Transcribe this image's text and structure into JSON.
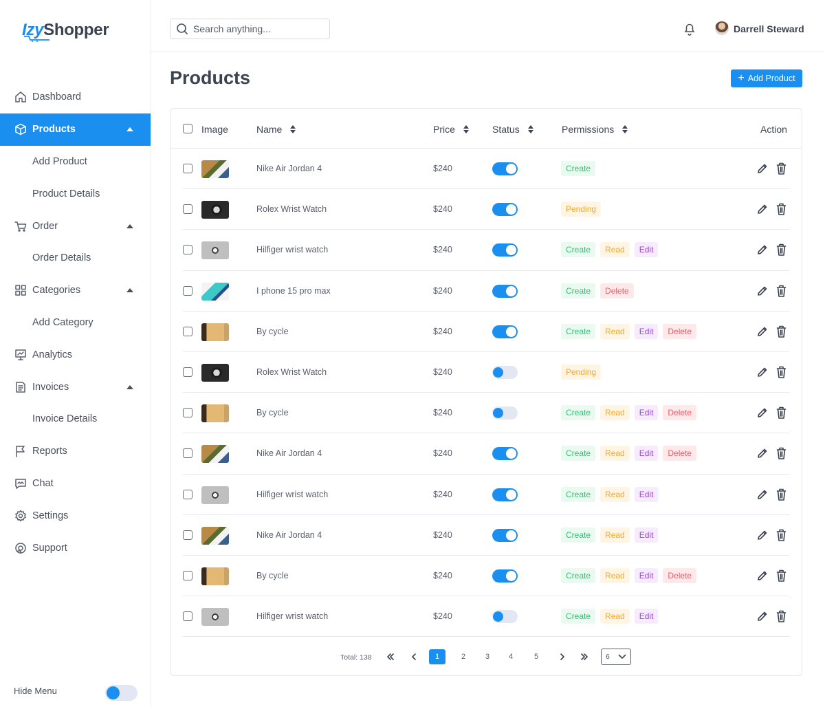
{
  "brand": {
    "part1": "Izy",
    "part2": "Shopper"
  },
  "search": {
    "placeholder": "Search anything..."
  },
  "user": {
    "name": "Darrell Steward"
  },
  "sidebar": {
    "items": [
      {
        "label": "Dashboard",
        "icon": "home-icon"
      },
      {
        "label": "Products",
        "icon": "box-icon"
      },
      {
        "label": "Add Product"
      },
      {
        "label": "Product Details"
      },
      {
        "label": "Order",
        "icon": "cart-icon"
      },
      {
        "label": "Order Details"
      },
      {
        "label": "Categories",
        "icon": "grid-icon"
      },
      {
        "label": "Add Category"
      },
      {
        "label": "Analytics",
        "icon": "monitor-icon"
      },
      {
        "label": "Invoices",
        "icon": "invoice-icon"
      },
      {
        "label": "Invoice Details"
      },
      {
        "label": "Reports",
        "icon": "flag-icon"
      },
      {
        "label": "Chat",
        "icon": "chat-icon"
      },
      {
        "label": "Settings",
        "icon": "gear-icon"
      },
      {
        "label": "Support",
        "icon": "support-icon"
      }
    ],
    "hide_menu": "Hide Menu"
  },
  "page": {
    "title": "Products",
    "add_button": "Add Product"
  },
  "table": {
    "headers": {
      "image": "Image",
      "name": "Name",
      "price": "Price",
      "status": "Status",
      "permissions": "Permissions",
      "action": "Action"
    },
    "rows": [
      {
        "name": "Nike Air Jordan 4",
        "price": "$240",
        "status": true,
        "image": "shoe",
        "perms": [
          "Create"
        ]
      },
      {
        "name": "Rolex Wrist Watch",
        "price": "$240",
        "status": true,
        "image": "watch",
        "perms": [
          "Pending"
        ]
      },
      {
        "name": "Hilfiger wrist watch",
        "price": "$240",
        "status": true,
        "image": "watch2",
        "perms": [
          "Create",
          "Read",
          "Edit"
        ]
      },
      {
        "name": "I phone 15 pro max",
        "price": "$240",
        "status": true,
        "image": "phone",
        "perms": [
          "Create",
          "Delete"
        ]
      },
      {
        "name": "By cycle",
        "price": "$240",
        "status": true,
        "image": "cycle",
        "perms": [
          "Create",
          "Read",
          "Edit",
          "Delete"
        ]
      },
      {
        "name": "Rolex Wrist Watch",
        "price": "$240",
        "status": false,
        "image": "watch",
        "perms": [
          "Pending"
        ]
      },
      {
        "name": "By cycle",
        "price": "$240",
        "status": false,
        "image": "cycle",
        "perms": [
          "Create",
          "Read",
          "Edit",
          "Delete"
        ]
      },
      {
        "name": "Nike Air Jordan 4",
        "price": "$240",
        "status": true,
        "image": "shoe",
        "perms": [
          "Create",
          "Read",
          "Edit",
          "Delete"
        ]
      },
      {
        "name": "Hilfiger wrist watch",
        "price": "$240",
        "status": true,
        "image": "watch2",
        "perms": [
          "Create",
          "Read",
          "Edit"
        ]
      },
      {
        "name": "Nike Air Jordan 4",
        "price": "$240",
        "status": true,
        "image": "shoe",
        "perms": [
          "Create",
          "Read",
          "Edit"
        ]
      },
      {
        "name": "By cycle",
        "price": "$240",
        "status": true,
        "image": "cycle",
        "perms": [
          "Create",
          "Read",
          "Edit",
          "Delete"
        ]
      },
      {
        "name": "Hilfiger wrist watch",
        "price": "$240",
        "status": false,
        "image": "watch2",
        "perms": [
          "Create",
          "Read",
          "Edit"
        ]
      }
    ]
  },
  "pagination": {
    "total": "Total: 138",
    "pages": [
      "1",
      "2",
      "3",
      "4",
      "5"
    ],
    "current": "1",
    "per_page": "6"
  },
  "colors": {
    "accent": "#1a8ff0",
    "create": "#35c074",
    "read": "#f2a72a",
    "edit": "#a23ee6",
    "delete": "#ef5a6a"
  }
}
